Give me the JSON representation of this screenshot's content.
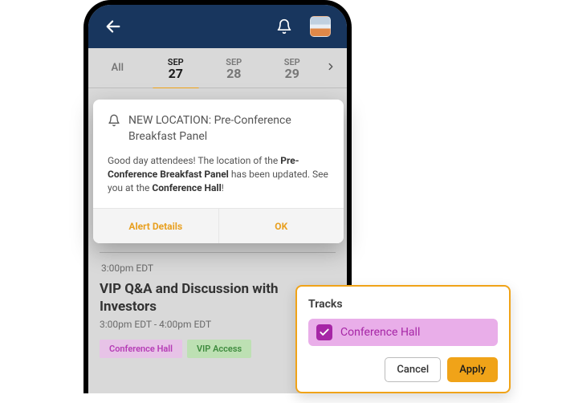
{
  "header": {
    "back_icon_name": "back-arrow-icon",
    "bell_icon_name": "bell-icon",
    "avatar_name": "user-avatar"
  },
  "tabs": {
    "all_label": "All",
    "items": [
      {
        "month": "SEP",
        "day": "27",
        "active": true
      },
      {
        "month": "SEP",
        "day": "28",
        "active": false
      },
      {
        "month": "SEP",
        "day": "29",
        "active": false
      }
    ],
    "chevron_name": "chevron-right-icon"
  },
  "modal": {
    "title": "NEW LOCATION: Pre-Conference Breakfast Panel",
    "body_prefix": "Good day attendees! The location of the ",
    "body_bold1": "Pre-Conference Breakfast Panel",
    "body_mid": " has been updated. See you at the ",
    "body_bold2": "Conference Hall",
    "body_suffix": "!",
    "action_details": "Alert Details",
    "action_ok": "OK"
  },
  "schedule": {
    "time_label": "3:00pm EDT",
    "event_title": "VIP Q&A and Discussion with Investors",
    "event_timespan": "3:00pm EDT - 4:00pm EDT",
    "badge_location": "Conference Hall",
    "badge_tag": "VIP Access"
  },
  "tracks_popup": {
    "title": "Tracks",
    "option_label": "Conference Hall",
    "option_checked": true,
    "cancel_label": "Cancel",
    "apply_label": "Apply"
  }
}
